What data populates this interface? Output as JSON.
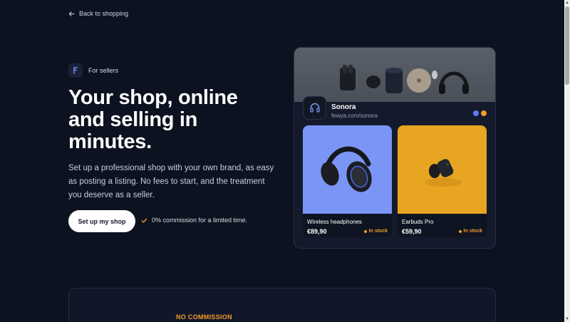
{
  "nav": {
    "back_label": "Back to shopping"
  },
  "hero": {
    "badge_label": "For sellers",
    "title": "Your shop, online and selling in minutes.",
    "subtitle": "Set up a professional shop with your own brand, as easy as posting a listing. No fees to start, and the treatment you deserve as a seller.",
    "cta_label": "Set up my shop",
    "note": "0% commission for a limited time."
  },
  "preview": {
    "store_name": "Sonora",
    "store_url": "fewya.com/sonora",
    "dot_colors": [
      "#5b7cf5",
      "#f39a2b"
    ],
    "products": [
      {
        "name": "Wireless headphones",
        "price": "€89,90",
        "stock": "In stock",
        "bg": "#7a95f5"
      },
      {
        "name": "Earbuds Pro",
        "price": "€59,90",
        "stock": "In stock",
        "bg": "#e8a521"
      }
    ]
  },
  "section": {
    "eyebrow": "NO COMMISSION"
  },
  "colors": {
    "accent": "#f39a2b",
    "background": "#0d1220",
    "brand_blue": "#5b7cf5"
  }
}
